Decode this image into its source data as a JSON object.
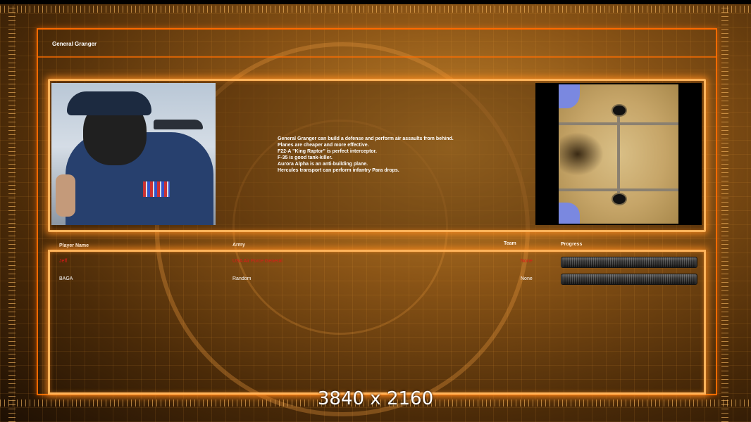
{
  "screen": {
    "general_name": "General Granger",
    "resolution_label": "3840 x 2160",
    "accent_color": "#ff6a00"
  },
  "description_lines": [
    "General Granger can build a defense and perform air assaults from behind.",
    "Planes are cheaper and more effective.",
    "F22-A \"King Raptor\" is perfect interceptor.",
    "F-35 is good tank-killer.",
    "Aurora Alpha is an anti-building plane.",
    "Hercules transport can perform infantry Para drops."
  ],
  "table": {
    "headers": {
      "player_name": "Player Name",
      "army": "Army",
      "team": "Team",
      "progress": "Progress"
    },
    "rows": [
      {
        "player": "Jeff",
        "army": "USA Air Force General",
        "team": "None",
        "progress": 0,
        "color": "#e01818"
      },
      {
        "player": "BAGA",
        "army": "Random",
        "team": "None",
        "progress": 0,
        "color": "#ffffff"
      }
    ]
  },
  "icons": {
    "portrait": "general-portrait-image",
    "map": "map-preview-image"
  }
}
